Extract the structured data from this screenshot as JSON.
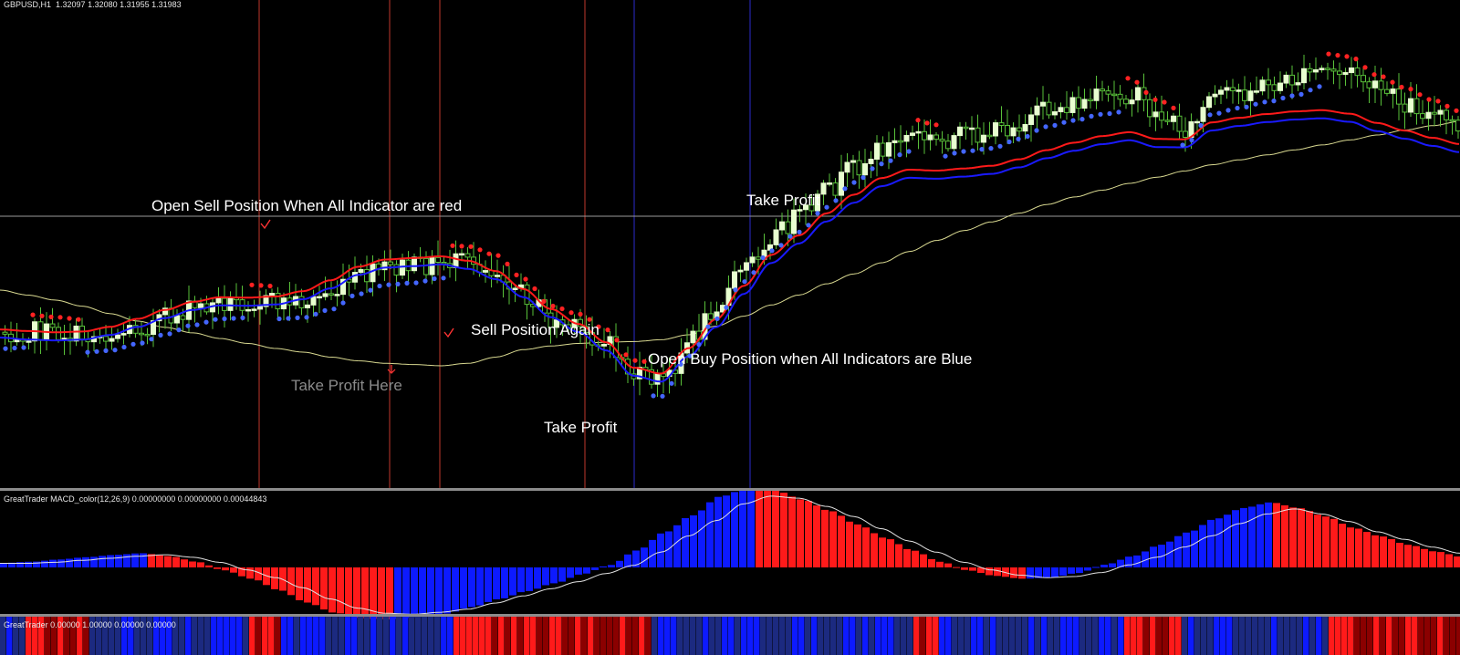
{
  "window": {
    "title": "GBPUSD,H1",
    "ohlc": "1.32097 1.32080 1.31955 1.31983"
  },
  "annotations": {
    "open_sell": "Open Sell Position When All Indicator are red",
    "sell_again": "Sell Position Again",
    "take_profit_here": "Take Profit Here",
    "take_profit_1": "Take Profit",
    "take_profit_2": "Take Profit",
    "open_buy": "Open Buy Position when All Indicators are Blue"
  },
  "subwindows": {
    "macd_label": "GreatTrader MACD_color(12,26,9) 0.00000000 0.00000000 0.00044843",
    "trader_label": "GreatTrader 0.00000 1.00000 0.00000 0.00000"
  },
  "colors": {
    "background": "#000000",
    "bull_candle": "#e8ffd0",
    "bear_candle": "#59c13a",
    "red_line": "#ff1a1a",
    "blue_line": "#1a1aff",
    "slow_ma": "#d8d890",
    "red_marker_vline": "#c0392b",
    "blue_marker_vline": "#2c2ccc",
    "histogram_red": "#ff1a1a",
    "histogram_blue": "#0d1aff",
    "signal_line": "#e0e0e0",
    "bar_dark_red": "#8b0000",
    "bar_navy": "#1c2a80"
  },
  "chart_data": {
    "type": "line",
    "symbol": "GBPUSD",
    "timeframe": "H1",
    "ohlc_readout": [
      1.32097,
      1.3208,
      1.31955,
      1.31983
    ],
    "price_series_shape": [
      0.32,
      0.34,
      0.3,
      0.26,
      0.29,
      0.4,
      0.55,
      0.7,
      0.8,
      0.82,
      0.8,
      0.82,
      0.95,
      1.2,
      1.35,
      1.38,
      1.46,
      1.44,
      1.3,
      0.92,
      0.48,
      0.35,
      0.1,
      -0.4,
      -0.45,
      0.2,
      0.8,
      1.4,
      1.9,
      2.2,
      2.6,
      3.0,
      3.3,
      3.5,
      3.4,
      3.5,
      3.55,
      3.7,
      3.9,
      4.0,
      4.1,
      4.15,
      3.8,
      3.6,
      4.1,
      4.2,
      4.3,
      4.4,
      4.55,
      4.5,
      4.2,
      4.0,
      3.8,
      3.62
    ],
    "series": [
      {
        "name": "",
        "color": "red",
        "shape": [
          0.3,
          0.25,
          0.24,
          0.28,
          0.38,
          0.52,
          0.66,
          0.78,
          0.84,
          0.82,
          0.86,
          0.98,
          1.18,
          1.38,
          1.48,
          1.5,
          1.5,
          1.4,
          1.22,
          0.98,
          0.72,
          0.42,
          0.1,
          -0.26,
          -0.38,
          -0.1,
          0.3,
          0.8,
          1.3,
          1.62,
          1.95,
          2.2,
          2.45,
          2.55,
          2.58,
          2.58,
          2.62,
          2.7,
          2.82,
          2.95,
          3.06,
          3.13,
          3.15,
          3.25,
          3.4,
          3.46,
          3.5,
          3.51,
          3.46,
          3.4,
          3.33,
          3.25,
          3.18,
          3.12
        ]
      },
      {
        "name": "",
        "color": "blue",
        "shape": [
          0.28,
          0.22,
          0.22,
          0.26,
          0.36,
          0.5,
          0.64,
          0.76,
          0.82,
          0.8,
          0.84,
          0.96,
          1.16,
          1.36,
          1.46,
          1.48,
          1.48,
          1.38,
          1.2,
          0.96,
          0.7,
          0.4,
          0.08,
          -0.28,
          -0.4,
          -0.12,
          0.28,
          0.78,
          1.28,
          1.6,
          1.93,
          2.18,
          2.43,
          2.53,
          2.56,
          2.56,
          2.6,
          2.68,
          2.8,
          2.93,
          3.04,
          3.11,
          3.13,
          3.23,
          3.38,
          3.44,
          3.48,
          3.49,
          3.44,
          3.38,
          3.31,
          3.23,
          3.16,
          3.1
        ]
      },
      {
        "name": "",
        "color": "yellow",
        "shape": [
          1.0,
          0.92,
          0.84,
          0.74,
          0.62,
          0.5,
          0.4,
          0.31,
          0.22,
          0.14,
          0.06,
          0.0,
          -0.08,
          -0.14,
          -0.18,
          -0.2,
          -0.22,
          -0.18,
          -0.08,
          0.04,
          0.1,
          0.14,
          0.16,
          0.17,
          0.2,
          0.28,
          0.42,
          0.58,
          0.76,
          0.92,
          1.1,
          1.26,
          1.44,
          1.62,
          1.8,
          1.96,
          2.1,
          2.24,
          2.38,
          2.5,
          2.61,
          2.72,
          2.82,
          2.92,
          3.02,
          3.1,
          3.18,
          3.26,
          3.34,
          3.42,
          3.5,
          3.58,
          3.65,
          3.72
        ]
      }
    ],
    "macd": {
      "histogram_shape": [
        0.08,
        0.1,
        0.14,
        0.18,
        0.22,
        0.25,
        0.2,
        0.1,
        -0.05,
        -0.2,
        -0.4,
        -0.62,
        -0.8,
        -0.9,
        -0.92,
        -0.88,
        -0.82,
        -0.7,
        -0.56,
        -0.42,
        -0.28,
        -0.12,
        0.04,
        0.3,
        0.62,
        0.92,
        1.25,
        1.4,
        1.36,
        1.2,
        1.0,
        0.76,
        0.52,
        0.3,
        0.1,
        -0.05,
        -0.15,
        -0.2,
        -0.18,
        -0.1,
        0.05,
        0.2,
        0.4,
        0.62,
        0.86,
        1.05,
        1.15,
        1.05,
        0.9,
        0.7,
        0.55,
        0.4,
        0.28,
        0.18
      ]
    }
  }
}
